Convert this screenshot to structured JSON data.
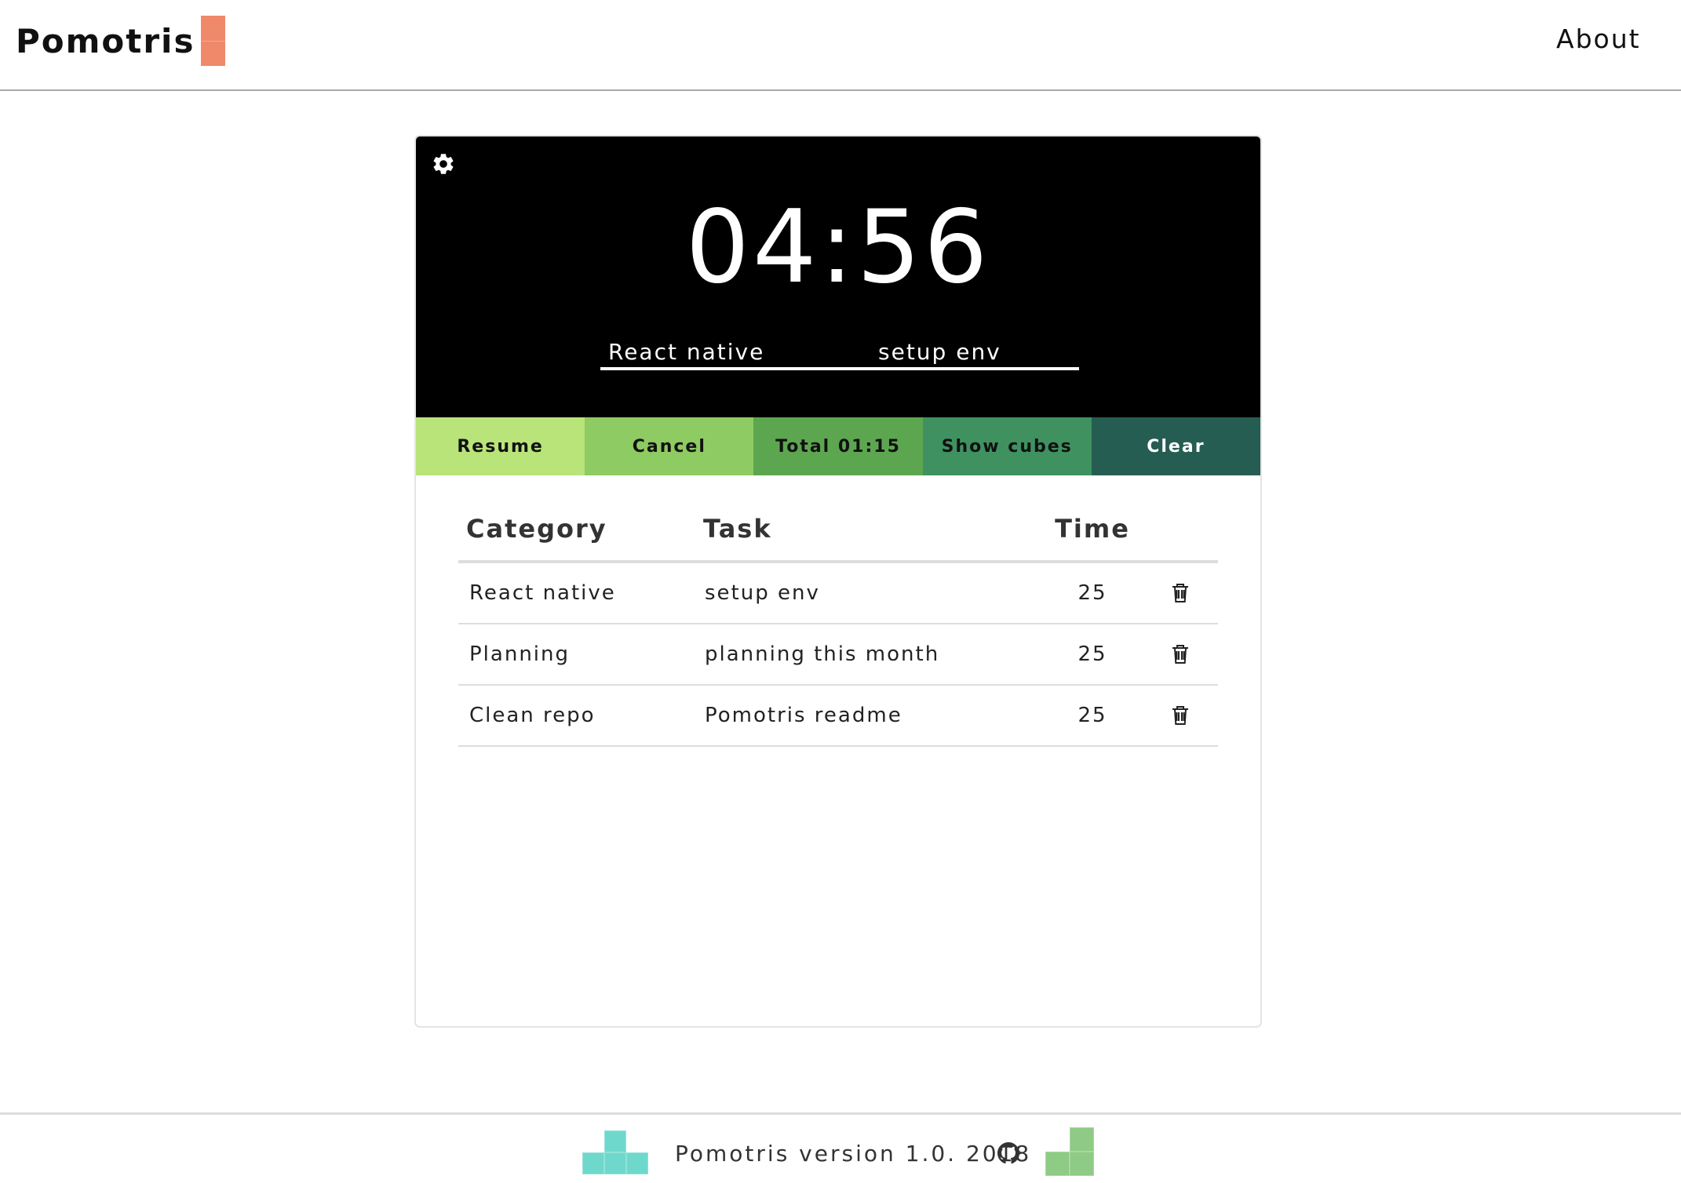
{
  "app": {
    "logo_text": "Pomotris",
    "nav": {
      "about_label": "About"
    },
    "brand_color": "#f0886a"
  },
  "timer": {
    "display": "04:56",
    "settings_icon": "gear-icon",
    "category_value": "React native",
    "task_value": "setup env"
  },
  "actions": [
    {
      "label": "Resume",
      "color": "#b8e47a",
      "text_color": "#111111"
    },
    {
      "label": "Cancel",
      "color": "#8ecb62",
      "text_color": "#111111"
    },
    {
      "label": "Total 01:15",
      "color": "#5da650",
      "text_color": "#111111"
    },
    {
      "label": "Show cubes",
      "color": "#3f9260",
      "text_color": "#111111"
    },
    {
      "label": "Clear",
      "color": "#265d52",
      "text_color": "#ffffff"
    }
  ],
  "table": {
    "headers": {
      "category": "Category",
      "task": "Task",
      "time": "Time"
    },
    "rows": [
      {
        "category": "React native",
        "task": "setup env",
        "time": "25",
        "delete_icon": "trash-icon"
      },
      {
        "category": "Planning",
        "task": "planning this month",
        "time": "25",
        "delete_icon": "trash-icon"
      },
      {
        "category": "Clean repo",
        "task": "Pomotris readme",
        "time": "25",
        "delete_icon": "trash-icon"
      }
    ]
  },
  "footer": {
    "text": "Pomotris version 1.0. 2018",
    "github_icon": "github-icon",
    "left_tetromino_color": "#6fd8cc",
    "right_tetromino_color": "#8ecb84"
  }
}
